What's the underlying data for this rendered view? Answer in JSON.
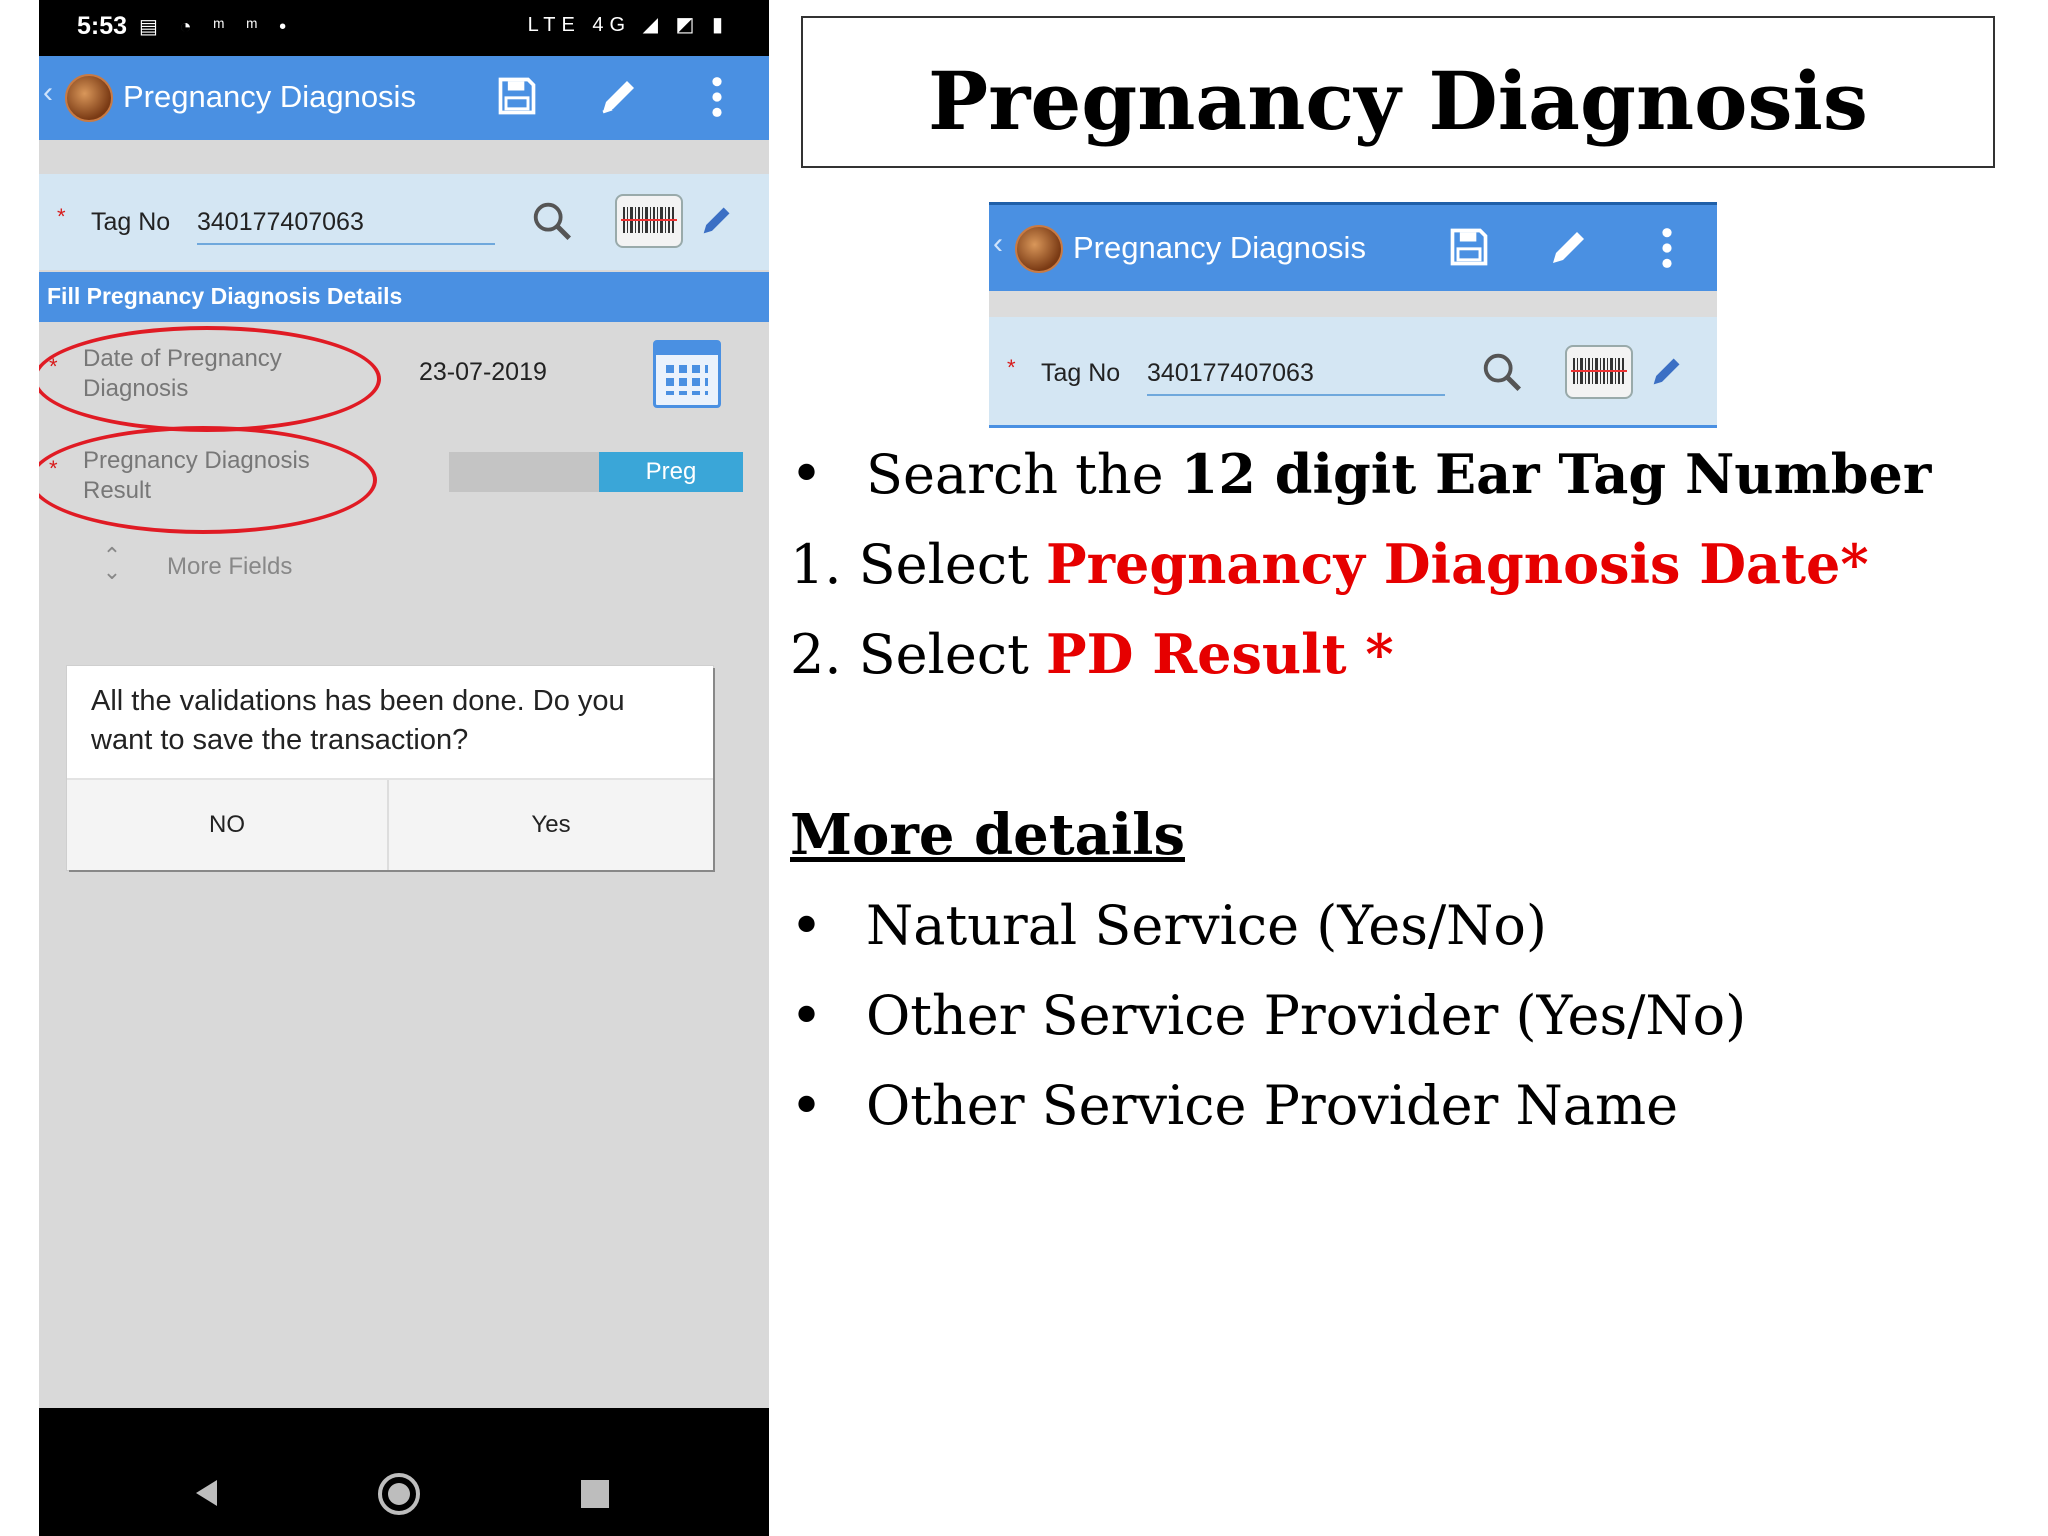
{
  "phone": {
    "status_bar": {
      "time": "5:53",
      "left_icons": "▤ ◔ ᵐ ᵐ •",
      "right_icons": "LTE 4G ◢ ◩ ▮"
    },
    "app_bar": {
      "back": "‹",
      "title": "Pregnancy Diagnosis"
    },
    "tag_field": {
      "required_mark": "*",
      "label": "Tag No",
      "value": "340177407063"
    },
    "section_header": "Fill Pregnancy Diagnosis Details",
    "date_field": {
      "required_mark": "*",
      "label": "Date of Pregnancy Diagnosis",
      "value": "23-07-2019"
    },
    "result_field": {
      "required_mark": "*",
      "label": "Pregnancy Diagnosis Result",
      "selected": "Preg"
    },
    "more_fields": "More Fields",
    "dialog": {
      "message": "All the validations has been done. Do you want to save the transaction?",
      "no_label": "NO",
      "yes_label": "Yes"
    },
    "nav": {
      "back": "◀",
      "home": "◉",
      "recents": "■"
    }
  },
  "slide": {
    "title": "Pregnancy Diagnosis",
    "mini_screenshot": {
      "back": "‹",
      "title": "Pregnancy Diagnosis",
      "required_mark": "*",
      "tag_label": "Tag No",
      "tag_value": "340177407063"
    },
    "steps": {
      "bullet": "•",
      "search_prefix": "Search the ",
      "search_bold": "12 digit Ear Tag Number",
      "step1_num": "1. Select ",
      "step1_red": "Pregnancy Diagnosis Date*",
      "step2_num": "2. Select ",
      "step2_red": "PD Result *"
    },
    "more_details": {
      "heading": "More details",
      "items": [
        "Natural Service (Yes/No)",
        "Other Service Provider (Yes/No)",
        "Other Service Provider Name"
      ]
    }
  },
  "colors": {
    "app_blue": "#4a90e2",
    "highlight_red": "#e01b24",
    "text_red": "#e60000",
    "toggle_blue": "#3aa6d8"
  }
}
